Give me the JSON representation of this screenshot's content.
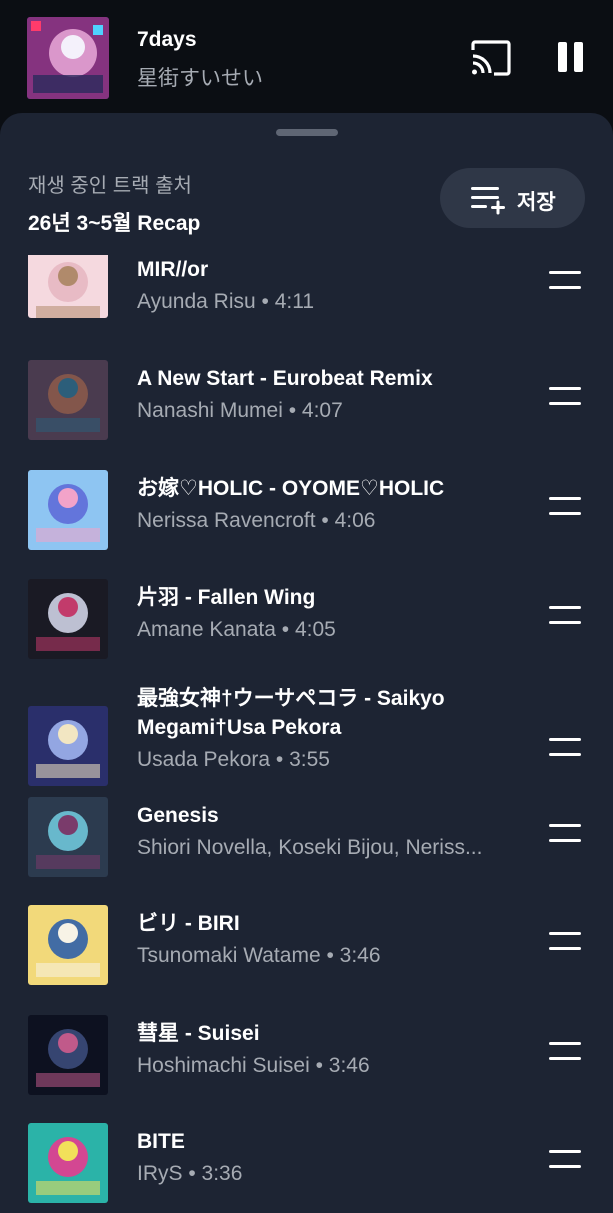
{
  "now_playing": {
    "title": "7days",
    "artist": "星街すいせい",
    "art_colors": [
      "#c32a73",
      "#3b3f8f",
      "#e9a9d8"
    ],
    "cast_icon": "cast-icon",
    "pause_icon": "pause-icon"
  },
  "queue": {
    "source_label": "재생 중인 트랙 출처",
    "source_name": "26년 3~5월 Recap",
    "save_label": "저장",
    "save_icon": "playlist-add-icon",
    "tracks": [
      {
        "title": "MIR//or",
        "subtitle": "Ayunda Risu • 4:11",
        "art": [
          "#f5d9df",
          "#e7b7c2",
          "#b08a6b"
        ]
      },
      {
        "title": "A New Start - Eurobeat Remix",
        "subtitle": "Nanashi Mumei • 4:07",
        "art": [
          "#4a3b4f",
          "#8a5a4a",
          "#2c5e7a"
        ]
      },
      {
        "title": "お嫁♡HOLIC - OYOME♡HOLIC",
        "subtitle": "Nerissa Ravencroft • 4:06",
        "art": [
          "#8ec5f2",
          "#5e6cd8",
          "#f2a3c9"
        ]
      },
      {
        "title": "片羽 - Fallen Wing",
        "subtitle": "Amane Kanata • 4:05",
        "art": [
          "#1a1a24",
          "#cfd3e6",
          "#c23b6b"
        ]
      },
      {
        "title": "最強女神†ウーサペコラ - Saikyo",
        "title2": "Megami†Usa Pekora",
        "subtitle": "Usada Pekora • 3:55",
        "art": [
          "#2a2f6b",
          "#9fb4f0",
          "#f2e6c2"
        ]
      },
      {
        "title": "Genesis",
        "subtitle": "Shiori Novella, Koseki Bijou, Neriss...",
        "art": [
          "#2c3b4f",
          "#6fc7d9",
          "#7a3b6b"
        ]
      },
      {
        "title": "ビリ - BIRI",
        "subtitle": "Tsunomaki Watame • 3:46",
        "art": [
          "#f2d97a",
          "#2f5fa8",
          "#f7f3e6"
        ]
      },
      {
        "title": "彗星 - Suisei",
        "subtitle": "Hoshimachi Suisei • 3:46",
        "art": [
          "#0d1120",
          "#3b4b7a",
          "#c05a8a"
        ]
      },
      {
        "title": "BITE",
        "subtitle": "IRyS • 3:36",
        "art": [
          "#2bb3a8",
          "#e63b8f",
          "#f2e05a"
        ]
      }
    ]
  }
}
